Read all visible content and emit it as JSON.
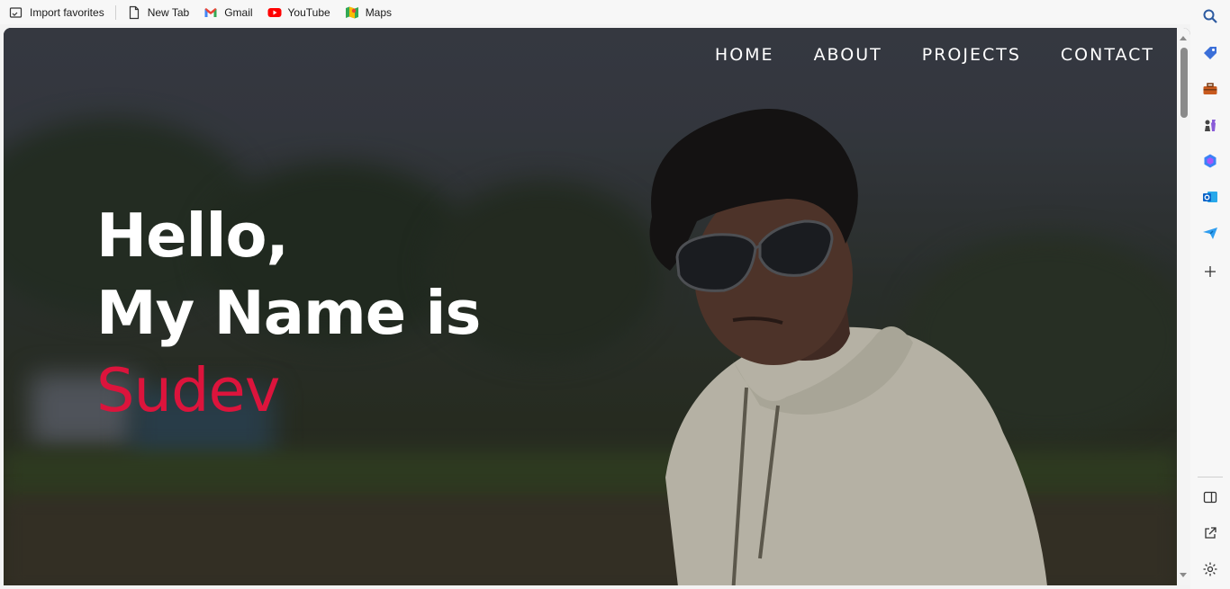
{
  "favorites_bar": {
    "items": [
      {
        "label": "Import favorites",
        "icon": "import-favorites-icon"
      },
      {
        "label": "New Tab",
        "icon": "page-icon"
      },
      {
        "label": "Gmail",
        "icon": "gmail-icon"
      },
      {
        "label": "YouTube",
        "icon": "youtube-icon"
      },
      {
        "label": "Maps",
        "icon": "maps-icon"
      }
    ]
  },
  "nav": {
    "items": [
      "HOME",
      "ABOUT",
      "PROJECTS",
      "CONTACT"
    ]
  },
  "hero": {
    "line1": "Hello,",
    "line2": "My Name is",
    "name": "Sudev",
    "accent_color": "#dc143c"
  },
  "sidebar": {
    "icons": [
      "search-icon",
      "tag-icon",
      "toolbox-icon",
      "chess-icon",
      "copilot-icon",
      "outlook-icon",
      "send-icon",
      "add-icon",
      "split-screen-icon",
      "external-link-icon",
      "settings-icon"
    ]
  }
}
